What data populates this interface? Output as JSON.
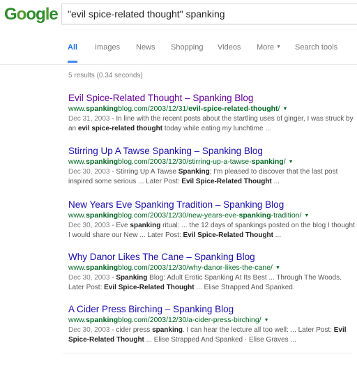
{
  "logo": {
    "letters": [
      "G",
      "o",
      "o",
      "g",
      "l",
      "e"
    ]
  },
  "search": {
    "query": "\"evil spice-related thought\" spanking"
  },
  "tabs": [
    "All",
    "Images",
    "News",
    "Shopping",
    "Videos",
    "More",
    "Search tools"
  ],
  "stats": "5 results (0.34 seconds)",
  "results": [
    {
      "title": "Evil Spice-Related Thought – Spanking Blog",
      "url_pre": "www.",
      "url_bold": "spanking",
      "url_mid": "blog.com/2003/12/31/",
      "url_bold2": "evil-spice-related-thought",
      "url_post": "/",
      "date": "Dec 31, 2003",
      "s1": " - In line with the recent posts about the startling uses of ginger, I was struck by an ",
      "s1b": "evil spice-related thought",
      "s2": " today while eating my lunchtime ...",
      "s2b": "",
      "s3": ""
    },
    {
      "title": "Stirring Up A Tawse Spanking – Spanking Blog",
      "url_pre": "www.",
      "url_bold": "spanking",
      "url_mid": "blog.com/2003/12/30/stirring-up-a-tawse-",
      "url_bold2": "spanking",
      "url_post": "/",
      "date": "Dec 30, 2003",
      "s1": " - Stirring Up A Tawse ",
      "s1b": "Spanking",
      "s2": ": I'm pleased to discover that the last post inspired some serious ... Later Post: ",
      "s2b": "Evil Spice-Related Thought",
      "s3": " ..."
    },
    {
      "title": "New Years Eve Spanking Tradition – Spanking Blog",
      "url_pre": "www.",
      "url_bold": "spanking",
      "url_mid": "blog.com/2003/12/30/new-years-eve-",
      "url_bold2": "spanking",
      "url_post": "-tradition/",
      "date": "Dec 30, 2003",
      "s1": " - Eve ",
      "s1b": "spanking",
      "s2": " ritual: ... the 12 days of spankings posted on the blog I thought I would share our New ... Later Post: ",
      "s2b": "Evil Spice-Related Thought",
      "s3": " ..."
    },
    {
      "title": "Why Danor Likes The Cane – Spanking Blog",
      "url_pre": "www.",
      "url_bold": "spanking",
      "url_mid": "blog.com/2003/12/30/why-danor-likes-the-cane/",
      "url_bold2": "",
      "url_post": "",
      "date": "Dec 30, 2003",
      "s1": " - ",
      "s1b": "Spanking",
      "s2": " Blog: Adult Erotic Spanking At Its Best ... Through The Woods. Later Post: ",
      "s2b": "Evil Spice-Related Thought",
      "s3": " ... Elise Strapped And Spanked."
    },
    {
      "title": "A Cider Press Birching – Spanking Blog",
      "url_pre": "www.",
      "url_bold": "spanking",
      "url_mid": "blog.com/2003/12/30/a-cider-press-birching/",
      "url_bold2": "",
      "url_post": "",
      "date": "Dec 30, 2003",
      "s1": " - cider press ",
      "s1b": "spanking",
      "s2": ". I can hear the lecture all too well: ... Later Post: ",
      "s2b": "Evil Spice-Related Thought",
      "s3": " ... Elise Strapped And Spanked · Elise Graves ..."
    }
  ]
}
